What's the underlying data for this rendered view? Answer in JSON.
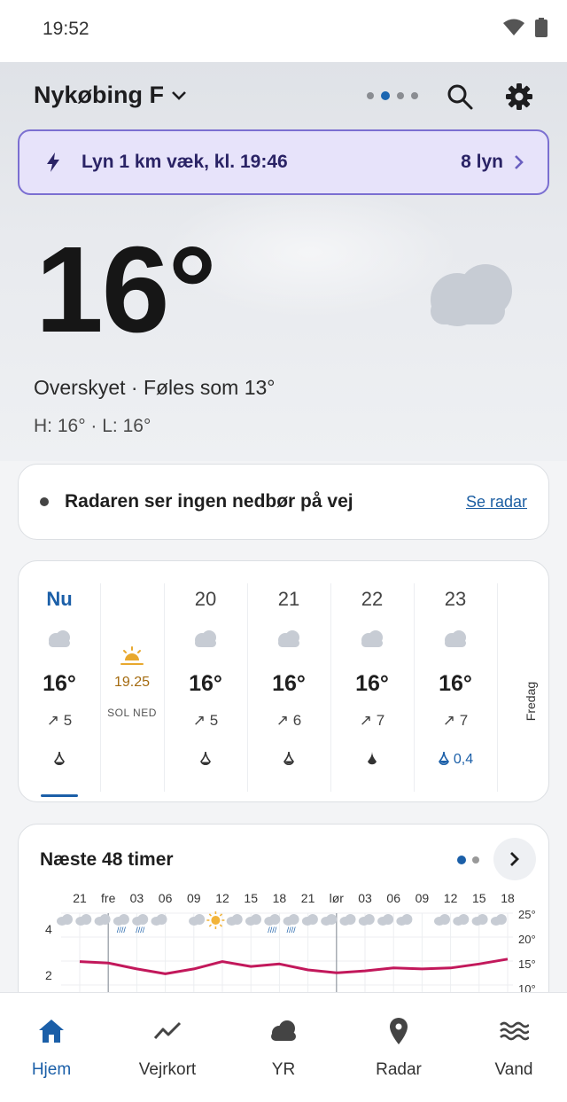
{
  "status_bar": {
    "time": "19:52"
  },
  "header": {
    "location": "Nykøbing F",
    "page_dots": 4,
    "active_dot": 1
  },
  "lightning": {
    "text": "Lyn 1 km væk, kl. 19:46",
    "count": "8 lyn"
  },
  "current": {
    "temperature": "16°",
    "condition": "Overskyet · Føles som 13°",
    "high_low": "H: 16° · L: 16°"
  },
  "radar": {
    "message": "Radaren ser ingen nedbør på vej",
    "link": "Se radar"
  },
  "hourly": {
    "now": {
      "label": "Nu",
      "temp": "16°",
      "wind": "5"
    },
    "sunset": {
      "time": "19.25",
      "label": "SOL NED"
    },
    "hours": [
      {
        "label": "20",
        "temp": "16°",
        "wind": "5",
        "precip": ""
      },
      {
        "label": "21",
        "temp": "16°",
        "wind": "6",
        "precip": ""
      },
      {
        "label": "22",
        "temp": "16°",
        "wind": "7",
        "precip": ""
      },
      {
        "label": "23",
        "temp": "16°",
        "wind": "7",
        "precip": "0,4"
      }
    ],
    "next_day": "Fredag"
  },
  "forecast48": {
    "title": "Næste 48 timer",
    "time_labels": [
      "21",
      "fre",
      "03",
      "06",
      "09",
      "12",
      "15",
      "18",
      "21",
      "lør",
      "03",
      "06",
      "09",
      "12",
      "15",
      "18"
    ],
    "left_axis": [
      "4",
      "2"
    ],
    "right_axis": [
      "25°",
      "20°",
      "15°",
      "10°"
    ]
  },
  "chart_data": {
    "type": "line",
    "title": "Næste 48 timer",
    "x": [
      "21",
      "fre",
      "03",
      "06",
      "09",
      "12",
      "15",
      "18",
      "21",
      "lør",
      "03",
      "06",
      "09",
      "12",
      "15",
      "18"
    ],
    "series": [
      {
        "values": [
          15.5,
          15.2,
          14.0,
          13.0,
          14.0,
          15.5,
          14.5,
          15.0,
          13.8,
          13.2,
          13.6,
          14.2,
          14.0,
          14.2,
          15.0,
          16.0
        ]
      }
    ],
    "ylim": [
      10,
      25
    ],
    "grid": true,
    "accent_color": "#c2185b"
  },
  "bottom_nav": [
    {
      "label": "Hjem",
      "icon": "home-icon",
      "active": true
    },
    {
      "label": "Vejrkort",
      "icon": "trend-icon",
      "active": false
    },
    {
      "label": "YR",
      "icon": "cloud-icon",
      "active": false
    },
    {
      "label": "Radar",
      "icon": "location-pin-icon",
      "active": false
    },
    {
      "label": "Vand",
      "icon": "waves-icon",
      "active": false
    }
  ],
  "colors": {
    "accent": "#1b5fa8",
    "lightning_bg": "#e7e3fa",
    "lightning_border": "#7b6fd1",
    "temp_line": "#c2185b"
  }
}
